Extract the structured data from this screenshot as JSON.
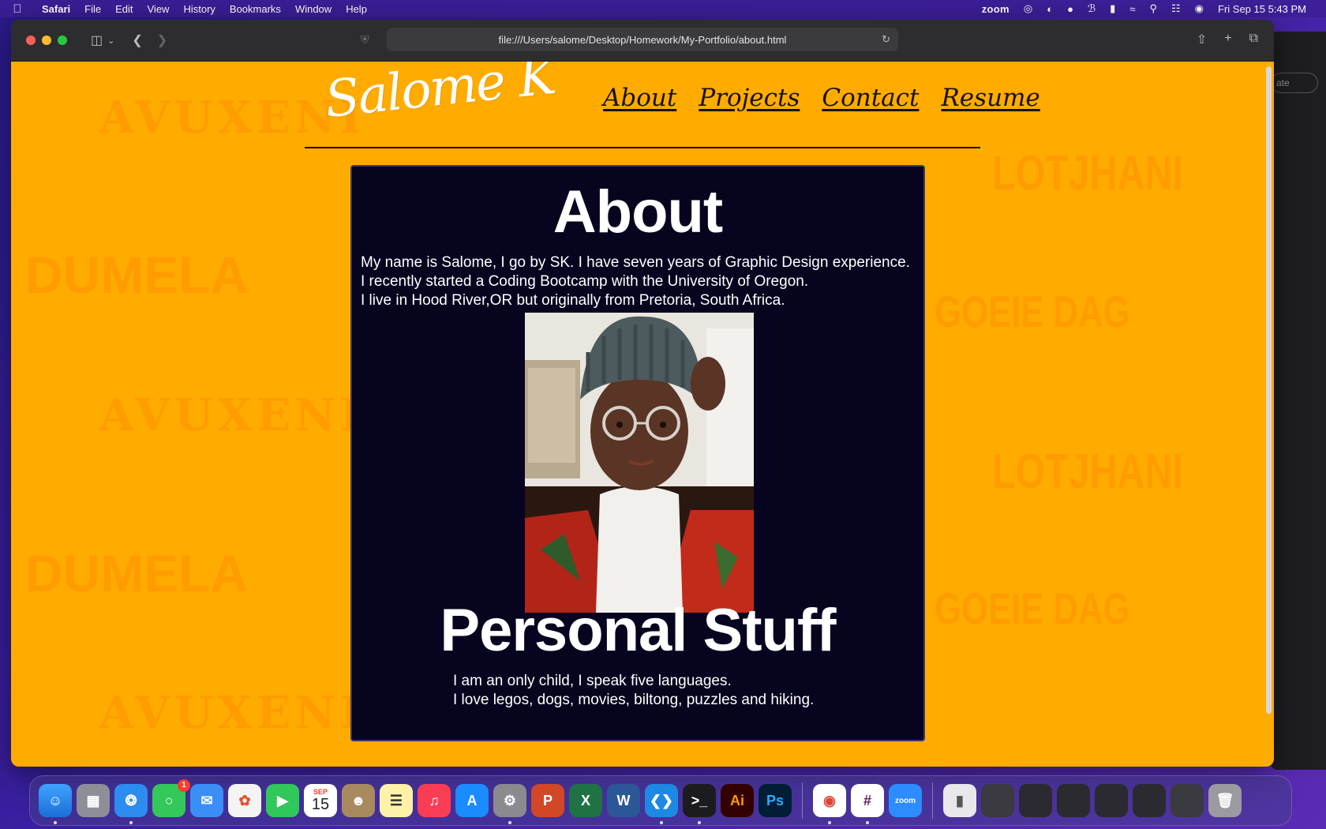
{
  "menubar": {
    "app_name": "Safari",
    "items": [
      "File",
      "Edit",
      "View",
      "History",
      "Bookmarks",
      "Window",
      "Help"
    ],
    "zoom_label": "zoom",
    "datetime": "Fri Sep 15  5:43 PM"
  },
  "browser": {
    "url": "file:///Users/salome/Desktop/Homework/My-Portfolio/about.html"
  },
  "background_words": {
    "avuxeni": "AVUXENI",
    "dumela": "DUMELA",
    "lotjhani": "LOTJHANI",
    "goeie_dag": "GOEIE DAG"
  },
  "site": {
    "logo": "Salome K",
    "nav": [
      "About",
      "Projects",
      "Contact",
      "Resume"
    ]
  },
  "about": {
    "heading": "About",
    "lines": [
      "My name is Salome, I go by SK. I have seven years of Graphic Design experience.",
      "I recently started a Coding Bootcamp with the University of Oregon.",
      "I live in Hood River,OR but originally from Pretoria, South Africa."
    ]
  },
  "personal": {
    "heading": "Personal Stuff",
    "lines": [
      "I am an only child, I speak five languages.",
      "I love legos, dogs, movies, biltong, puzzles and hiking."
    ]
  },
  "behind_window": {
    "button_label": "ate"
  },
  "dock": {
    "calendar_month": "SEP",
    "calendar_day": "15",
    "messages_badge": "1",
    "icons": [
      "finder-icon",
      "launchpad-icon",
      "safari-icon",
      "messages-icon",
      "mail-icon",
      "photos-icon",
      "facetime-icon",
      "calendar-icon",
      "contacts-icon",
      "notes-icon",
      "music-icon",
      "app-store-icon",
      "system-settings-icon",
      "powerpoint-icon",
      "excel-icon",
      "word-icon",
      "vscode-icon",
      "terminal-icon",
      "illustrator-icon",
      "photoshop-icon",
      "chrome-icon",
      "slack-icon",
      "zoom-icon"
    ],
    "labels": {
      "illustrator": "Ai",
      "photoshop": "Ps",
      "zoom": "zoom"
    }
  },
  "colors": {
    "page_bg": "#ffab00",
    "card_bg": "#06041f",
    "bg_word": "#ff9a00"
  }
}
